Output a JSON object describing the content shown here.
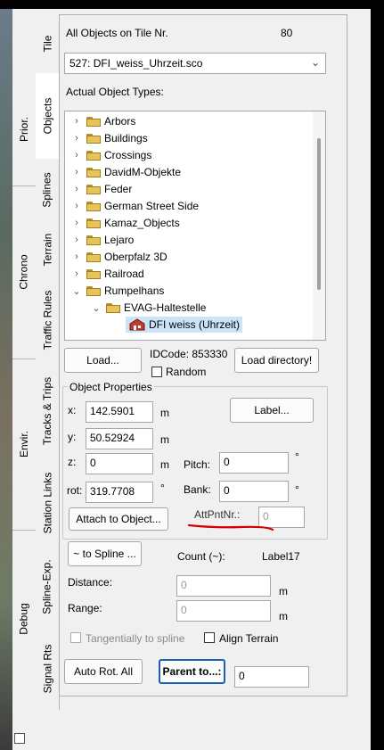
{
  "tabs_outer": [
    "Prior.",
    "Chrono",
    "Envir.",
    "Debug"
  ],
  "tabs_inner": [
    "Tile",
    "Objects",
    "Splines",
    "Terrain",
    "Traffic Rules",
    "Tracks & Trips",
    "Station Links",
    "Spline-Exp.",
    "Signal Rts"
  ],
  "header": {
    "label": "All Objects on Tile Nr.",
    "tile_nr": "80"
  },
  "file_select": {
    "value": "527: DFI_weiss_Uhrzeit.sco"
  },
  "types_label": "Actual Object Types:",
  "tree": {
    "items": [
      "Arbors",
      "Buildings",
      "Crossings",
      "DavidM-Objekte",
      "Feder",
      "German Street Side",
      "Kamaz_Objects",
      "Lejaro",
      "Oberpfalz 3D",
      "Railroad",
      "Rumpelhans"
    ],
    "sub_item": "EVAG-Haltestelle",
    "leaf_item": "DFI weiss (Uhrzeit)"
  },
  "buttons": {
    "load": "Load...",
    "load_directory": "Load directory!",
    "label": "Label...",
    "attach": "Attach to Object...",
    "to_spline": "~ to Spline ...",
    "auto_rot": "Auto Rot. All",
    "parent": "Parent to...:"
  },
  "idcode": {
    "label": "IDCode: 853330",
    "random": "Random"
  },
  "props": {
    "title": "Object Properties",
    "x_label": "x:",
    "x_value": "142.5901",
    "x_unit": "m",
    "y_label": "y:",
    "y_value": "50.52924",
    "y_unit": "m",
    "z_label": "z:",
    "z_value": "0",
    "z_unit": "m",
    "rot_label": "rot:",
    "rot_value": "319.7708",
    "rot_unit": "°",
    "pitch_label": "Pitch:",
    "pitch_value": "0",
    "pitch_unit": "°",
    "bank_label": "Bank:",
    "bank_value": "0",
    "bank_unit": "°",
    "attpnt_label": "AttPntNr.:",
    "attpnt_value": "0"
  },
  "spline": {
    "count_label": "Count (~):",
    "count_value": "Label17",
    "distance_label": "Distance:",
    "distance_value": "0",
    "distance_unit": "m",
    "range_label": "Range:",
    "range_value": "0",
    "range_unit": "m",
    "tangential": "Tangentially to spline",
    "align_terrain": "Align Terrain"
  },
  "parent_value": "0",
  "colors": {
    "annotation_line": "#d40000",
    "selection": "#cce4f7"
  }
}
